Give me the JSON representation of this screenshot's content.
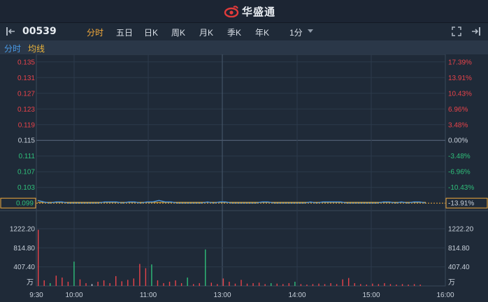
{
  "app": {
    "brand": "华盛通"
  },
  "toolbar": {
    "stock_code": "00539",
    "tabs": [
      {
        "label": "分时",
        "active": true
      },
      {
        "label": "五日",
        "active": false
      },
      {
        "label": "日K",
        "active": false
      },
      {
        "label": "周K",
        "active": false
      },
      {
        "label": "月K",
        "active": false
      },
      {
        "label": "季K",
        "active": false
      },
      {
        "label": "年K",
        "active": false
      },
      {
        "label": "1分",
        "active": false
      }
    ]
  },
  "legend": {
    "intraday": "分时",
    "average": "均线"
  },
  "colors": {
    "up": "#e8434a",
    "down": "#2fbf7a",
    "flat": "#c9d1db",
    "price_line": "#4a9be8",
    "avg_line": "#e8b23b",
    "accent": "#f2a93b"
  },
  "chart_data": {
    "type": "line",
    "price_axis": {
      "left_ticks": [
        "0.135",
        "0.131",
        "0.127",
        "0.123",
        "0.119",
        "0.115",
        "0.111",
        "0.107",
        "0.103"
      ],
      "right_ticks": [
        "17.39%",
        "13.91%",
        "10.43%",
        "6.96%",
        "3.48%",
        "0.00%",
        "-3.48%",
        "-6.96%",
        "-10.43%"
      ],
      "ylim": [
        0.0985,
        0.1355
      ],
      "prev_close": 0.115
    },
    "current_price_label": "0.099",
    "current_change_label": "-13.91%",
    "time_ticks": [
      "9:30",
      "10:00",
      "11:00",
      "13:00",
      "14:00",
      "15:00",
      "16:00"
    ],
    "volume_axis": {
      "ticks": [
        "1222.20",
        "814.80",
        "407.40"
      ],
      "unit": "万",
      "max": 1222.2
    },
    "price_series": [
      0.0997,
      0.0993,
      0.099,
      0.0993,
      0.0993,
      0.099,
      0.099,
      0.099,
      0.099,
      0.099,
      0.099,
      0.0993,
      0.0993,
      0.0993,
      0.099,
      0.0993,
      0.0993,
      0.099,
      0.0993,
      0.0993,
      0.0997,
      0.0993,
      0.0993,
      0.099,
      0.099,
      0.099,
      0.099,
      0.099,
      0.0993,
      0.099,
      0.0993,
      0.0993,
      0.099,
      0.099,
      0.099,
      0.099,
      0.099,
      0.0993,
      0.0993,
      0.099,
      0.099,
      0.099,
      0.099,
      0.099,
      0.099,
      0.0993,
      0.099,
      0.0993,
      0.0993,
      0.0993,
      0.0993,
      0.099,
      0.099,
      0.099,
      0.099,
      0.099,
      0.099,
      0.0993,
      0.0993,
      0.099,
      0.0993,
      0.099,
      0.0993,
      0.0993,
      0.099
    ],
    "avg_series": [
      0.0992,
      0.0992,
      0.0992,
      0.0992,
      0.0992,
      0.0992,
      0.0992,
      0.0992,
      0.0992,
      0.0992,
      0.0992,
      0.0992,
      0.0992,
      0.0992,
      0.0992,
      0.0992,
      0.0992,
      0.0992,
      0.0992,
      0.0992,
      0.0992,
      0.0992,
      0.0992,
      0.0992,
      0.0992,
      0.0992,
      0.0992,
      0.0992,
      0.0992,
      0.0992,
      0.0992,
      0.0992,
      0.0992,
      0.0992,
      0.0992,
      0.0992,
      0.0992,
      0.0992,
      0.0992,
      0.0992,
      0.0992,
      0.0992,
      0.0992,
      0.0992,
      0.0992,
      0.0992,
      0.0992,
      0.0992,
      0.0992,
      0.0992,
      0.0992,
      0.0992,
      0.0992,
      0.0992,
      0.0992,
      0.0992,
      0.0992,
      0.0992,
      0.0992,
      0.0992,
      0.0992,
      0.0992,
      0.0992,
      0.0992,
      0.0992
    ],
    "volume_series": [
      {
        "v": 1200,
        "d": "up"
      },
      {
        "v": 120,
        "d": "up"
      },
      {
        "v": 60,
        "d": "down"
      },
      {
        "v": 220,
        "d": "up"
      },
      {
        "v": 180,
        "d": "up"
      },
      {
        "v": 90,
        "d": "up"
      },
      {
        "v": 520,
        "d": "down"
      },
      {
        "v": 140,
        "d": "up"
      },
      {
        "v": 60,
        "d": "up"
      },
      {
        "v": 40,
        "d": "flat"
      },
      {
        "v": 90,
        "d": "up"
      },
      {
        "v": 120,
        "d": "up"
      },
      {
        "v": 60,
        "d": "up"
      },
      {
        "v": 210,
        "d": "up"
      },
      {
        "v": 100,
        "d": "up"
      },
      {
        "v": 130,
        "d": "up"
      },
      {
        "v": 160,
        "d": "up"
      },
      {
        "v": 470,
        "d": "up"
      },
      {
        "v": 380,
        "d": "up"
      },
      {
        "v": 460,
        "d": "down"
      },
      {
        "v": 120,
        "d": "up"
      },
      {
        "v": 60,
        "d": "up"
      },
      {
        "v": 90,
        "d": "up"
      },
      {
        "v": 120,
        "d": "up"
      },
      {
        "v": 60,
        "d": "up"
      },
      {
        "v": 180,
        "d": "down"
      },
      {
        "v": 40,
        "d": "up"
      },
      {
        "v": 60,
        "d": "up"
      },
      {
        "v": 780,
        "d": "down"
      },
      {
        "v": 70,
        "d": "up"
      },
      {
        "v": 40,
        "d": "up"
      },
      {
        "v": 160,
        "d": "up"
      },
      {
        "v": 90,
        "d": "up"
      },
      {
        "v": 50,
        "d": "up"
      },
      {
        "v": 130,
        "d": "up"
      },
      {
        "v": 50,
        "d": "up"
      },
      {
        "v": 60,
        "d": "up"
      },
      {
        "v": 70,
        "d": "up"
      },
      {
        "v": 40,
        "d": "up"
      },
      {
        "v": 60,
        "d": "down"
      },
      {
        "v": 50,
        "d": "up"
      },
      {
        "v": 40,
        "d": "up"
      },
      {
        "v": 60,
        "d": "up"
      },
      {
        "v": 90,
        "d": "down"
      },
      {
        "v": 40,
        "d": "up"
      },
      {
        "v": 30,
        "d": "up"
      },
      {
        "v": 40,
        "d": "up"
      },
      {
        "v": 50,
        "d": "up"
      },
      {
        "v": 40,
        "d": "up"
      },
      {
        "v": 60,
        "d": "up"
      },
      {
        "v": 40,
        "d": "up"
      },
      {
        "v": 140,
        "d": "up"
      },
      {
        "v": 170,
        "d": "up"
      },
      {
        "v": 60,
        "d": "up"
      },
      {
        "v": 40,
        "d": "up"
      },
      {
        "v": 30,
        "d": "up"
      },
      {
        "v": 50,
        "d": "up"
      },
      {
        "v": 40,
        "d": "up"
      },
      {
        "v": 60,
        "d": "up"
      },
      {
        "v": 40,
        "d": "up"
      },
      {
        "v": 30,
        "d": "up"
      },
      {
        "v": 40,
        "d": "up"
      },
      {
        "v": 30,
        "d": "up"
      },
      {
        "v": 40,
        "d": "up"
      },
      {
        "v": 30,
        "d": "up"
      }
    ]
  }
}
